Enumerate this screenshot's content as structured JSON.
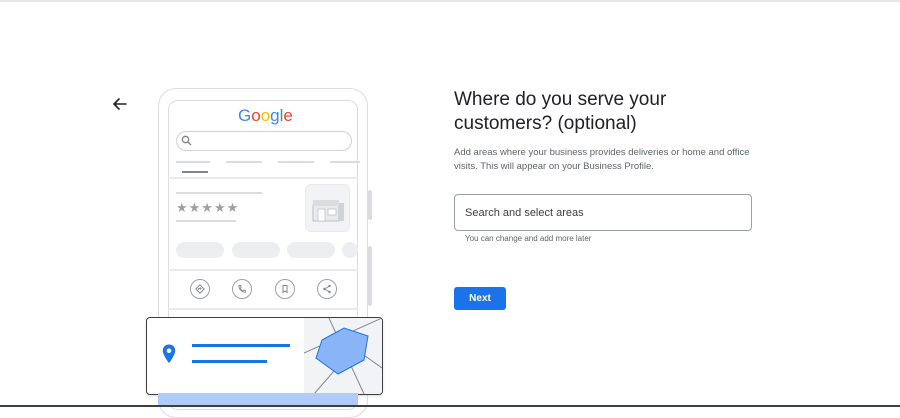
{
  "page": {
    "title": "Where do you serve your customers? (optional)",
    "description": "Add areas where your business provides deliveries or home and office visits. This will appear on your Business Profile.",
    "search": {
      "placeholder": "Search and select areas",
      "value": ""
    },
    "helper_text": "You can change and add more later",
    "next_label": "Next"
  },
  "illustration": {
    "logo": {
      "letters": [
        "G",
        "o",
        "o",
        "g",
        "l",
        "e"
      ]
    },
    "colors": {
      "blue": "#4285F4",
      "red": "#EA4335",
      "yellow": "#FBBC05",
      "green": "#34A853",
      "map_fill": "#8ab4f8",
      "pin": "#1a73e8"
    },
    "rating_stars": "★★★★★"
  },
  "icons": {
    "back": "arrow-left-icon",
    "search": "magnifier-icon",
    "directions": "directions-icon",
    "call": "phone-icon",
    "save": "bookmark-icon",
    "share": "share-icon",
    "location": "location-pin-icon"
  },
  "colors": {
    "primary": "#1a73e8",
    "text": "#202124",
    "secondary_text": "#5f6368"
  }
}
